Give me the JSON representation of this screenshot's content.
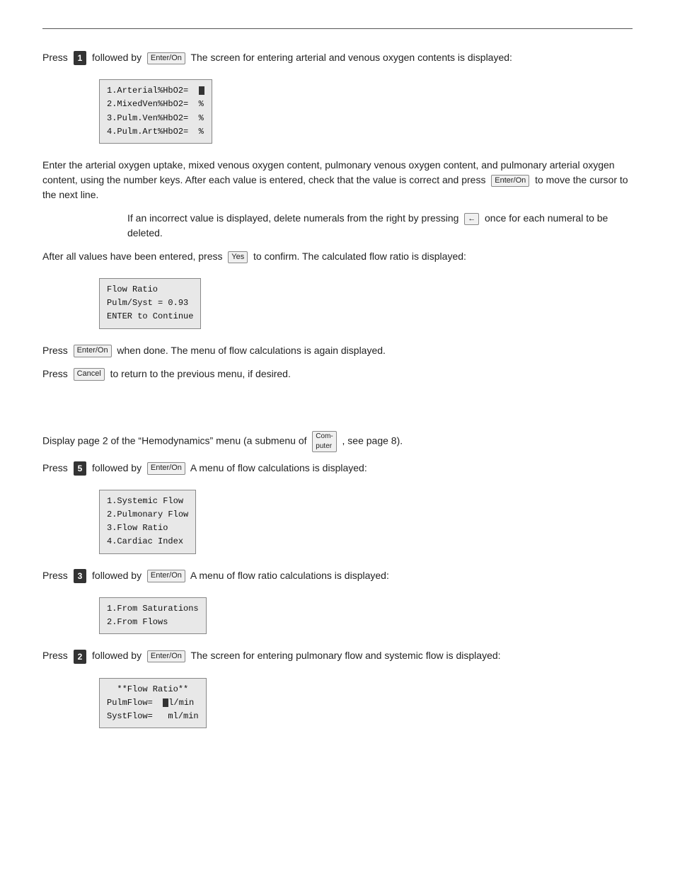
{
  "divider": true,
  "sections": [
    {
      "id": "section1",
      "para1": {
        "prefix": "Press",
        "key_num": "1",
        "middle": "followed by",
        "key1": "Enter/On",
        "suffix": "The screen for entering arterial and venous oxygen contents is displayed:"
      },
      "screen1": {
        "lines": [
          "1.Arterial%HbO2=  ■",
          "2.MixedVen%HbO2=  %",
          "3.Pulm.Ven%HbO2=  %",
          "4.Pulm.Art%HbO2=  %"
        ]
      },
      "para2": "Enter the arterial oxygen uptake, mixed venous oxygen content, pulmonary venous oxygen content, and pulmonary arterial oxygen content, using the number keys. After each value is entered, check that the value is correct and press",
      "para2_key": "Enter/On",
      "para2_suffix": "to move the cursor to the next line.",
      "indent_para": {
        "text": "If an incorrect value is displayed, delete numerals from the right by pressing",
        "key": "←",
        "suffix": "once for each numeral to be deleted."
      },
      "para3": {
        "prefix": "After all values have been entered, press",
        "key": "Yes",
        "suffix": "to confirm. The calculated flow ratio is displayed:"
      },
      "screen2": {
        "lines": [
          "Flow Ratio",
          "Pulm/Syst = 0.93",
          "ENTER to Continue"
        ]
      },
      "para4": {
        "prefix": "Press",
        "key": "Enter/On",
        "suffix": "when done. The menu of flow calculations is again displayed."
      },
      "para5": {
        "prefix": "Press",
        "key": "Cancel",
        "suffix": "to return to the previous menu, if desired."
      }
    },
    {
      "id": "section2",
      "para_display": {
        "text": "Display page 2 of the “Hemodynamics” menu (a submenu of",
        "key": "Compu-ter",
        "suffix": ", see page 8)."
      },
      "para1": {
        "prefix": "Press",
        "key_num": "5",
        "middle": "followed by",
        "key1": "Enter/On",
        "suffix": "A menu of flow calculations is displayed:"
      },
      "screen1": {
        "lines": [
          "1.Systemic Flow",
          "2.Pulmonary Flow",
          "3.Flow Ratio",
          "4.Cardiac Index"
        ]
      },
      "para2": {
        "prefix": "Press",
        "key_num": "3",
        "middle": "followed by",
        "key1": "Enter/On",
        "suffix": "A menu of flow ratio calculations is displayed:"
      },
      "screen2": {
        "lines": [
          "1.From Saturations",
          "2.From Flows"
        ]
      },
      "para3": {
        "prefix": "Press",
        "key_num": "2",
        "middle": "followed by",
        "key1": "Enter/On",
        "suffix": "The screen for entering pulmonary flow and systemic flow is displayed:"
      },
      "screen3": {
        "lines": [
          "  **Flow Ratio**",
          "PulmFlow=  ■l/min",
          "SystFlow=   ml/min"
        ]
      }
    }
  ]
}
